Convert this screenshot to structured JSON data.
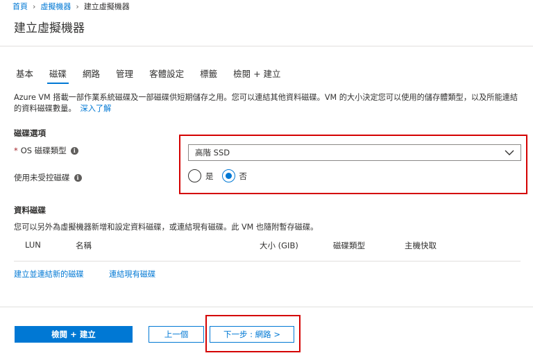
{
  "breadcrumb": {
    "home": "首頁",
    "vms": "虛擬機器",
    "current": "建立虛擬機器"
  },
  "page_title": "建立虛擬機器",
  "tabs": [
    {
      "label": "基本"
    },
    {
      "label": "磁碟"
    },
    {
      "label": "網路"
    },
    {
      "label": "管理"
    },
    {
      "label": "客體設定"
    },
    {
      "label": "標籤"
    },
    {
      "label": "檢閱 + 建立"
    }
  ],
  "active_tab": "磁碟",
  "description": {
    "text": "Azure VM 搭載一部作業系統磁碟及一部磁碟供短期儲存之用。您可以連結其他資料磁碟。VM 的大小決定您可以使用的儲存體類型，以及所能連結的資料磁碟數量。",
    "learn_more": "深入了解"
  },
  "disk_options": {
    "title": "磁碟選項",
    "os_disk_type_label": "OS 磁碟類型",
    "required_mark": "*",
    "os_disk_type_value": "高階 SSD",
    "unmanaged_label": "使用未受控磁碟",
    "radio_yes": "是",
    "radio_no": "否",
    "selected": "否"
  },
  "data_disks": {
    "title": "資料磁碟",
    "description": "您可以另外為虛擬機器新增和設定資料磁碟，或連結現有磁碟。此 VM 也隨附暫存磁碟。",
    "columns": [
      "LUN",
      "名稱",
      "大小 (GIB)",
      "磁碟類型",
      "主機快取"
    ],
    "link_create": "建立並連結新的磁碟",
    "link_attach": "連結現有磁碟"
  },
  "footer": {
    "review_create": "檢閱 + 建立",
    "previous": "上一個",
    "next": "下一步 : 網路 >"
  },
  "colors": {
    "accent": "#0078d4",
    "highlight": "#d40000",
    "required": "#a4262c"
  },
  "icons": {
    "info": "info-icon",
    "dropdown": "chevron-down-icon",
    "breadcrumb_separator": "chevron-right-icon"
  }
}
